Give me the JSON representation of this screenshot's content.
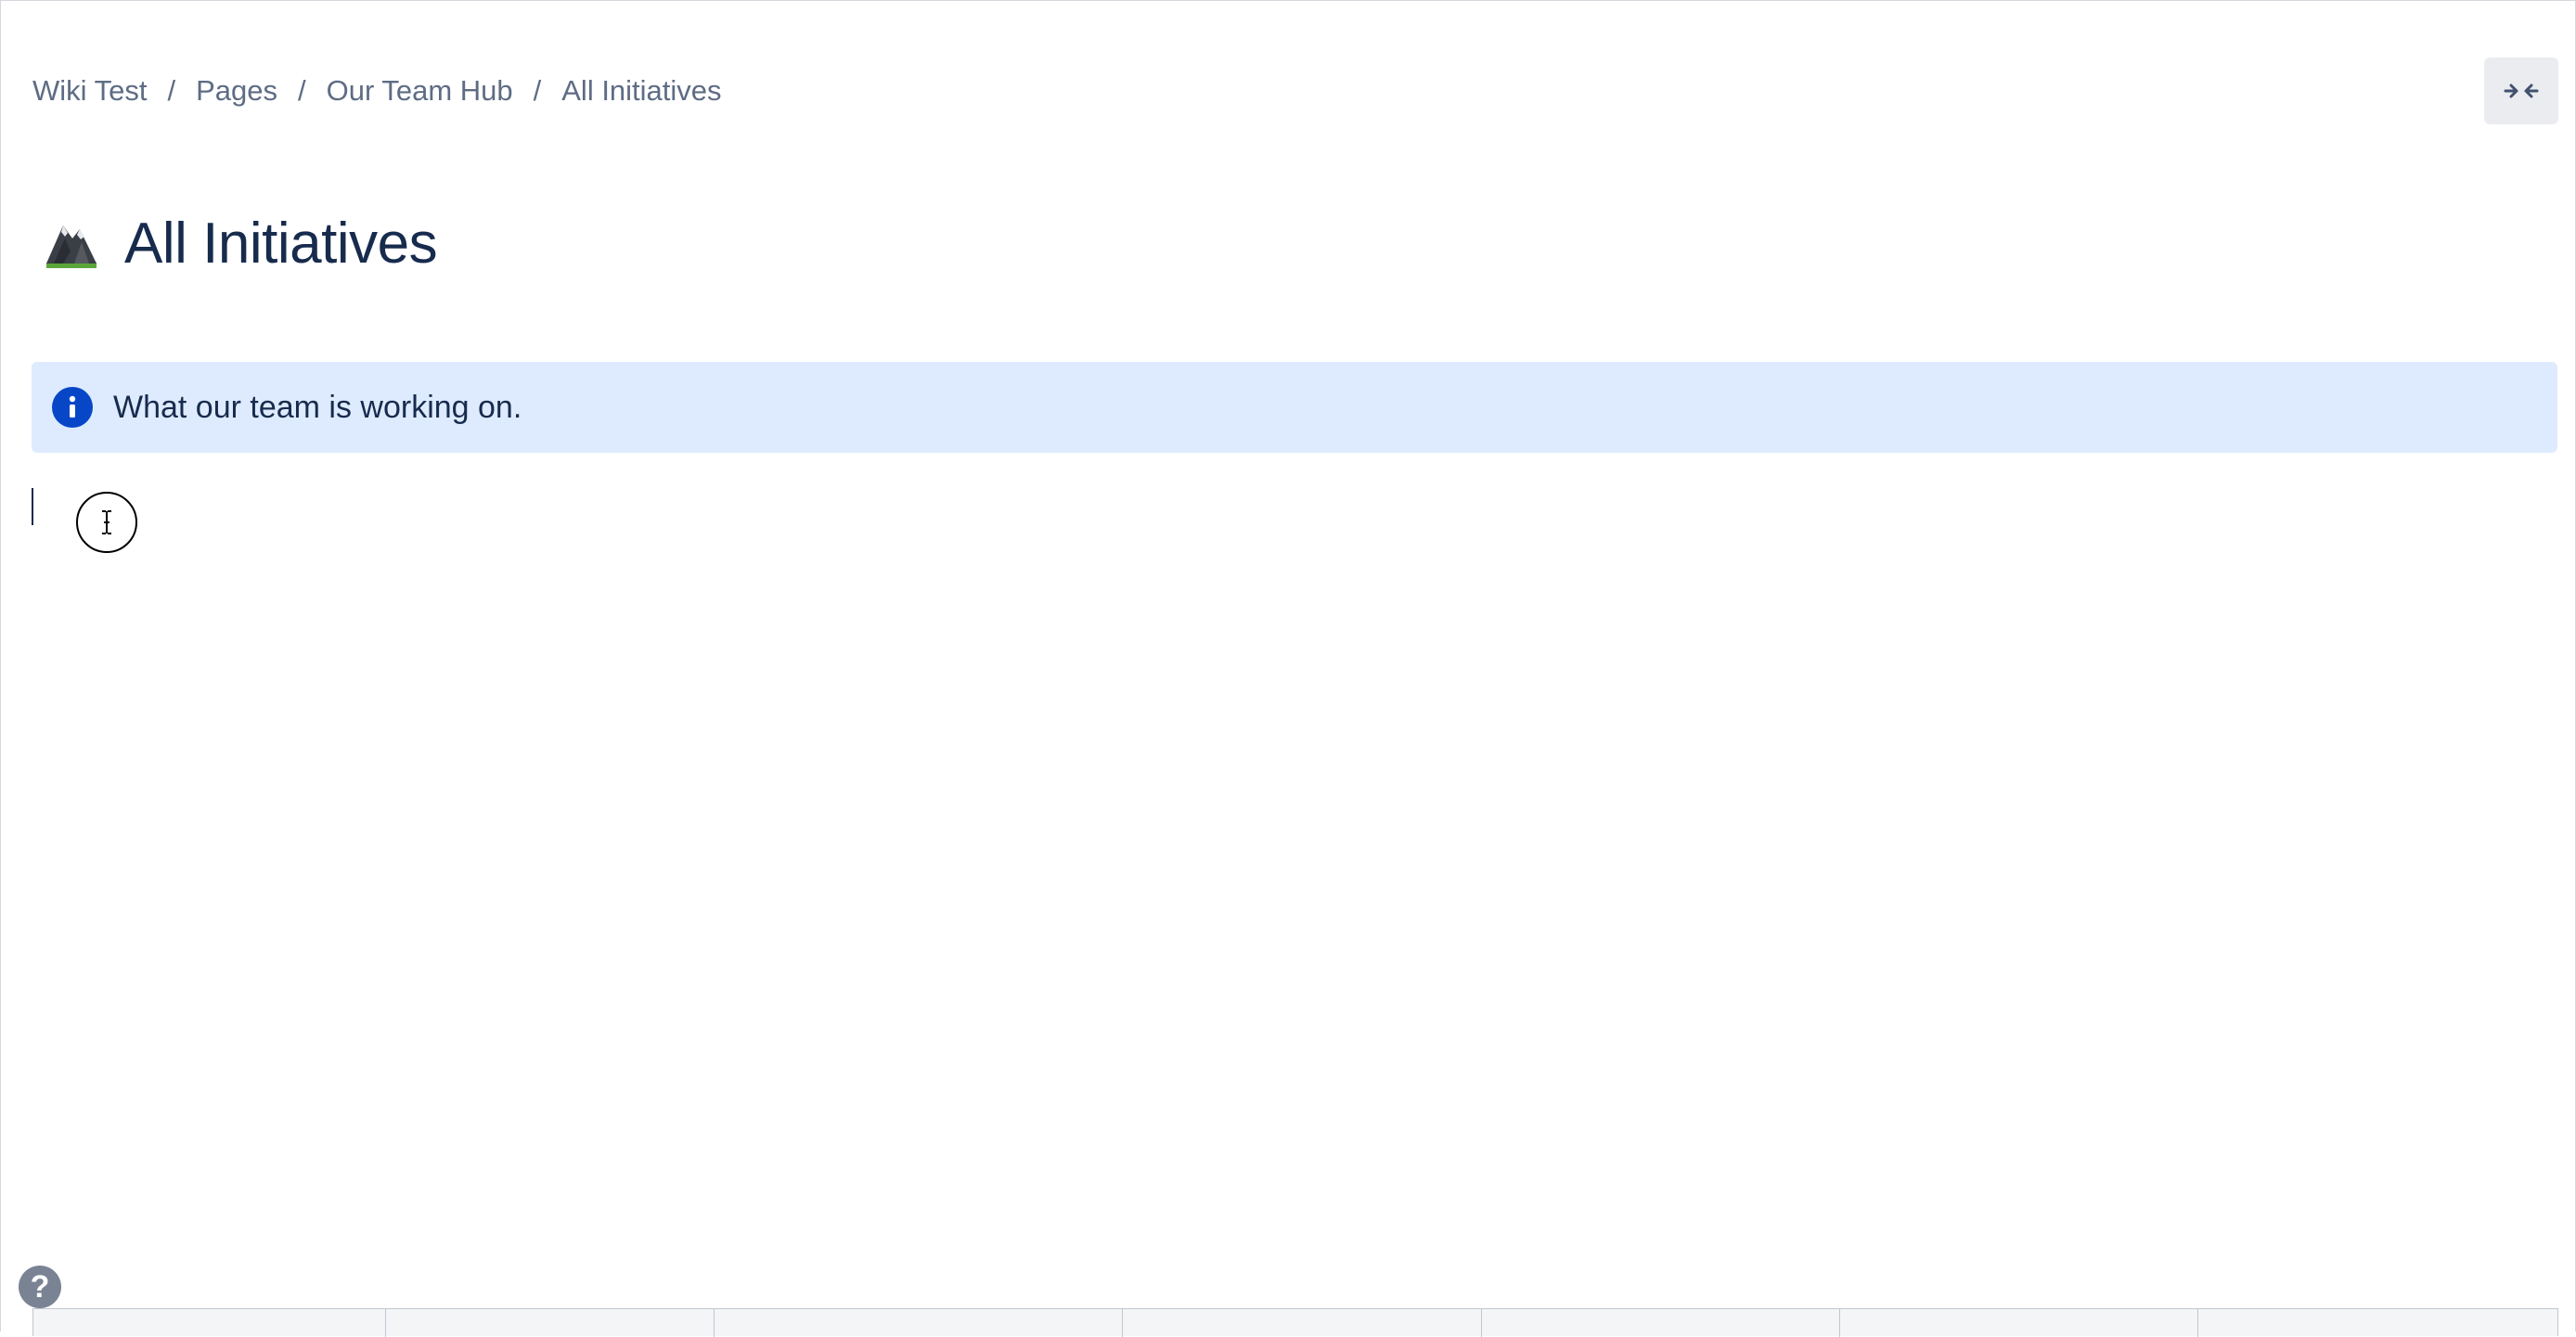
{
  "breadcrumb": {
    "items": [
      "Wiki Test",
      "Pages",
      "Our Team Hub",
      "All Initiatives"
    ],
    "separator": "/"
  },
  "page": {
    "title": "All Initiatives",
    "emoji_icon": "mountain-icon"
  },
  "info_panel": {
    "icon": "info-icon",
    "text": "What our team is working on."
  },
  "toolbar": {
    "collapse_icon": "collapse-arrows-icon"
  },
  "help": {
    "label": "?"
  },
  "colors": {
    "info_bg": "#deebff",
    "info_icon": "#0747c7",
    "title": "#172b4d",
    "breadcrumb": "#5e6c84"
  }
}
